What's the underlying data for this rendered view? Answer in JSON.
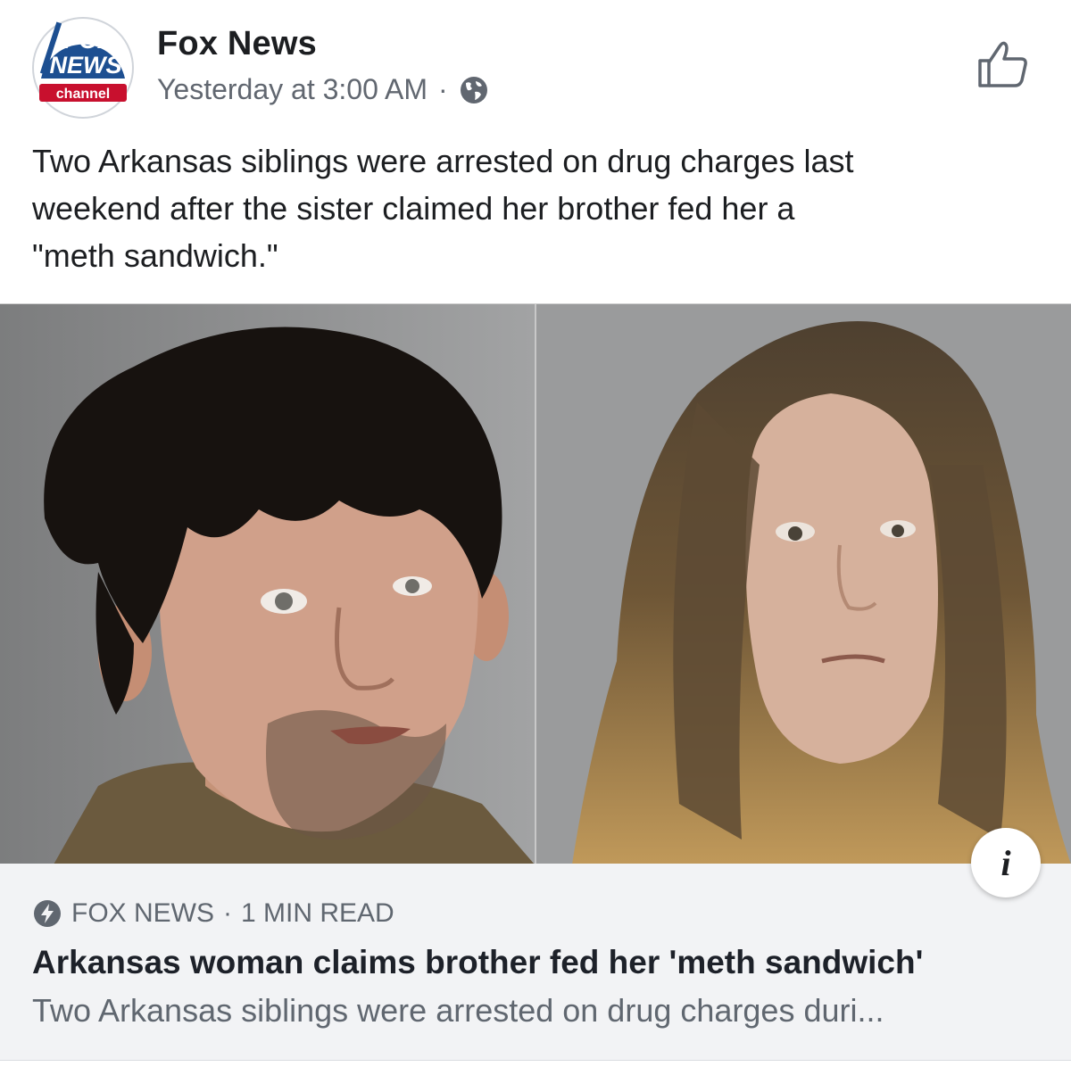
{
  "post": {
    "page_name": "Fox News",
    "timestamp": "Yesterday at 3:00 AM",
    "separator": "·",
    "privacy_icon": "globe-icon",
    "like_icon": "thumbs-up-icon",
    "text": "Two Arkansas siblings were arrested on drug charges last\nweekend after the sister claimed her brother fed her a\n\"meth sandwich.\""
  },
  "logo": {
    "line1": "FOX",
    "line2": "NEWS",
    "line3": "channel",
    "color_blue": "#1d4f91",
    "color_red": "#c8102e"
  },
  "image": {
    "info_icon": "info-icon",
    "info_glyph": "i"
  },
  "link_card": {
    "source_icon": "lightning-bolt-icon",
    "source": "FOX NEWS",
    "separator": "·",
    "read_time": "1 MIN READ",
    "headline": "Arkansas woman claims brother fed her 'meth sandwich'",
    "description": "Two Arkansas siblings were arrested on drug charges duri..."
  }
}
